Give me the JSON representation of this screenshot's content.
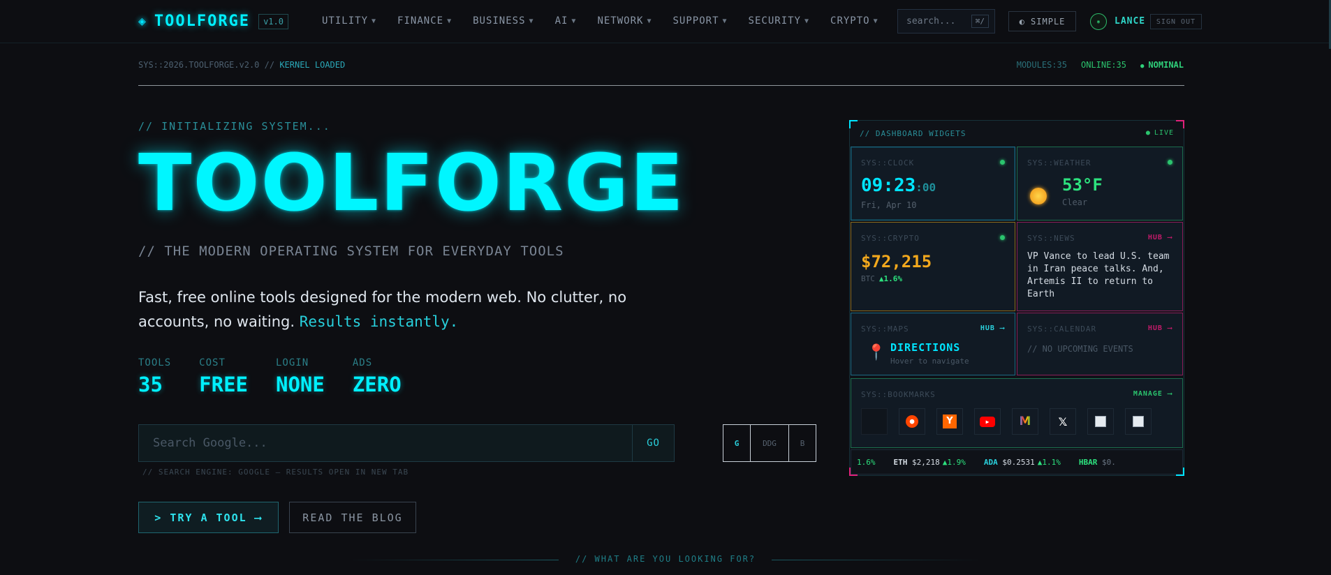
{
  "nav": {
    "logo_icon": "◈",
    "brand": "TOOLFORGE",
    "version": "v1.0",
    "menu": [
      {
        "label": "UTILITY"
      },
      {
        "label": "FINANCE"
      },
      {
        "label": "BUSINESS"
      },
      {
        "label": "AI"
      },
      {
        "label": "NETWORK"
      },
      {
        "label": "SUPPORT"
      },
      {
        "label": "SECURITY"
      },
      {
        "label": "CRYPTO"
      }
    ],
    "search_placeholder": "search...",
    "search_shortcut": "⌘/",
    "mode_button": "◐ SIMPLE",
    "user": "LANCE",
    "sign_out": "SIGN OUT"
  },
  "status": {
    "sys": "SYS::2026.TOOLFORGE.v2.0 //",
    "kernel": "KERNEL LOADED",
    "modules": "MODULES:35",
    "online": "ONLINE:35",
    "health": "NOMINAL"
  },
  "hero": {
    "init": "// INITIALIZING SYSTEM...",
    "title": "TOOLFORGE",
    "tagline": "// THE MODERN OPERATING SYSTEM FOR EVERYDAY TOOLS",
    "desc": "Fast, free online tools designed for the modern web. No clutter, no accounts, no waiting.",
    "desc_highlight": "Results instantly.",
    "stats": [
      {
        "label": "TOOLS",
        "value": "35"
      },
      {
        "label": "COST",
        "value": "FREE"
      },
      {
        "label": "LOGIN",
        "value": "NONE"
      },
      {
        "label": "ADS",
        "value": "ZERO"
      }
    ],
    "search_placeholder": "Search Google...",
    "go": "GO",
    "engines": [
      "G",
      "DDG",
      "B"
    ],
    "engine_note": "// SEARCH ENGINE: GOOGLE — RESULTS OPEN IN NEW TAB",
    "try_button": "> TRY A TOOL ⟶",
    "blog_button": "READ THE BLOG",
    "looking": "// WHAT ARE YOU LOOKING FOR?"
  },
  "dashboard": {
    "title": "// DASHBOARD WIDGETS",
    "live": "LIVE",
    "clock": {
      "title": "SYS::CLOCK",
      "hm": "09:23",
      "sec": ":00",
      "date": "Fri, Apr 10"
    },
    "weather": {
      "title": "SYS::WEATHER",
      "temp": "53°F",
      "cond": "Clear"
    },
    "crypto": {
      "title": "SYS::CRYPTO",
      "price": "$72,215",
      "symbol": "BTC",
      "change": "▲1.6%"
    },
    "news": {
      "title": "SYS::NEWS",
      "hub": "HUB ⟶",
      "headline": "VP Vance to lead U.S. team in Iran peace talks. And, Artemis II to return to Earth"
    },
    "maps": {
      "title": "SYS::MAPS",
      "hub": "HUB ⟶",
      "label": "DIRECTIONS",
      "sub": "Hover to navigate"
    },
    "calendar": {
      "title": "SYS::CALENDAR",
      "hub": "HUB ⟶",
      "empty": "// NO UPCOMING EVENTS"
    },
    "bookmarks": {
      "title": "SYS::BOOKMARKS",
      "manage": "MANAGE ⟶"
    },
    "ticker": [
      {
        "name": "",
        "price": "",
        "change": "1.6%"
      },
      {
        "name": "ETH",
        "price": "$2,218",
        "change": "▲1.9%"
      },
      {
        "name": "ADA",
        "price": "$0.2531",
        "change": "▲1.1%"
      },
      {
        "name": "HBAR",
        "price": "$0.",
        "change": ""
      }
    ]
  },
  "colors": {
    "accent": "#00f0ff",
    "green": "#2de27e",
    "gold": "#f2a81d",
    "magenta": "#e0217a"
  }
}
